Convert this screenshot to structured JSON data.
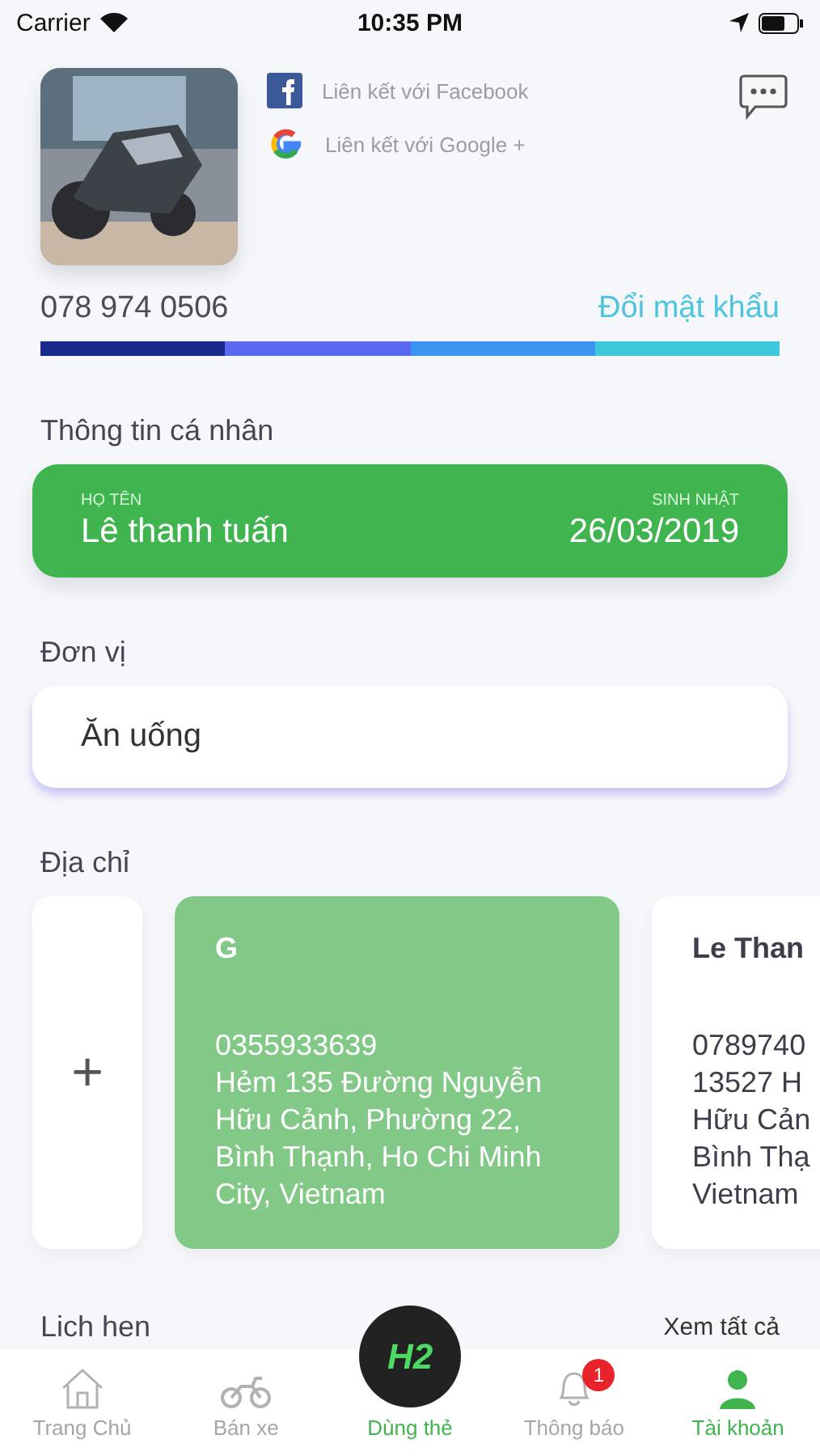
{
  "status_bar": {
    "carrier": "Carrier",
    "time": "10:35 PM"
  },
  "profile": {
    "links": [
      {
        "kind": "facebook",
        "label": "Liên kết với Facebook"
      },
      {
        "kind": "google",
        "label": "Liên kết với Google +"
      }
    ],
    "phone": "078 974 0506",
    "change_password": "Đổi mật khẩu"
  },
  "strength_bar": [
    {
      "color": "#1a2a8c"
    },
    {
      "color": "#5a6af0"
    },
    {
      "color": "#3a94f0"
    },
    {
      "color": "#3ec8dc"
    }
  ],
  "personal": {
    "title": "Thông tin cá nhân",
    "name_label": "HỌ TÊN",
    "name": "Lê thanh tuấn",
    "birthday_label": "SINH NHẬT",
    "birthday": "26/03/2019"
  },
  "unit": {
    "title": "Đơn vị",
    "value": "Ăn uống"
  },
  "addresses": {
    "title": "Địa chỉ",
    "add": "+",
    "cards": [
      {
        "selected": true,
        "name": "G",
        "lines": [
          "0355933639",
          "Hẻm 135 Đường Nguyễn",
          "Hữu Cảnh, Phường 22,",
          "Bình Thạnh, Ho Chi Minh",
          "City, Vietnam"
        ]
      },
      {
        "selected": false,
        "name": "Le Than",
        "lines": [
          "0789740",
          "13527 H",
          "Hữu Cản",
          "Bình Thạ",
          "Vietnam"
        ]
      }
    ]
  },
  "appointments": {
    "title": "Lich hen",
    "see_all": "Xem tất cả"
  },
  "tab_bar": {
    "logo": "H2",
    "tabs": [
      {
        "kind": "home",
        "label": "Trang Chủ",
        "selected": false
      },
      {
        "kind": "bike",
        "label": "Bán xe",
        "selected": false
      },
      {
        "kind": "center",
        "label": "Dùng thẻ",
        "selected": false
      },
      {
        "kind": "bell",
        "label": "Thông báo",
        "selected": false,
        "badge": "1"
      },
      {
        "kind": "user",
        "label": "Tài khoản",
        "selected": true
      }
    ]
  }
}
